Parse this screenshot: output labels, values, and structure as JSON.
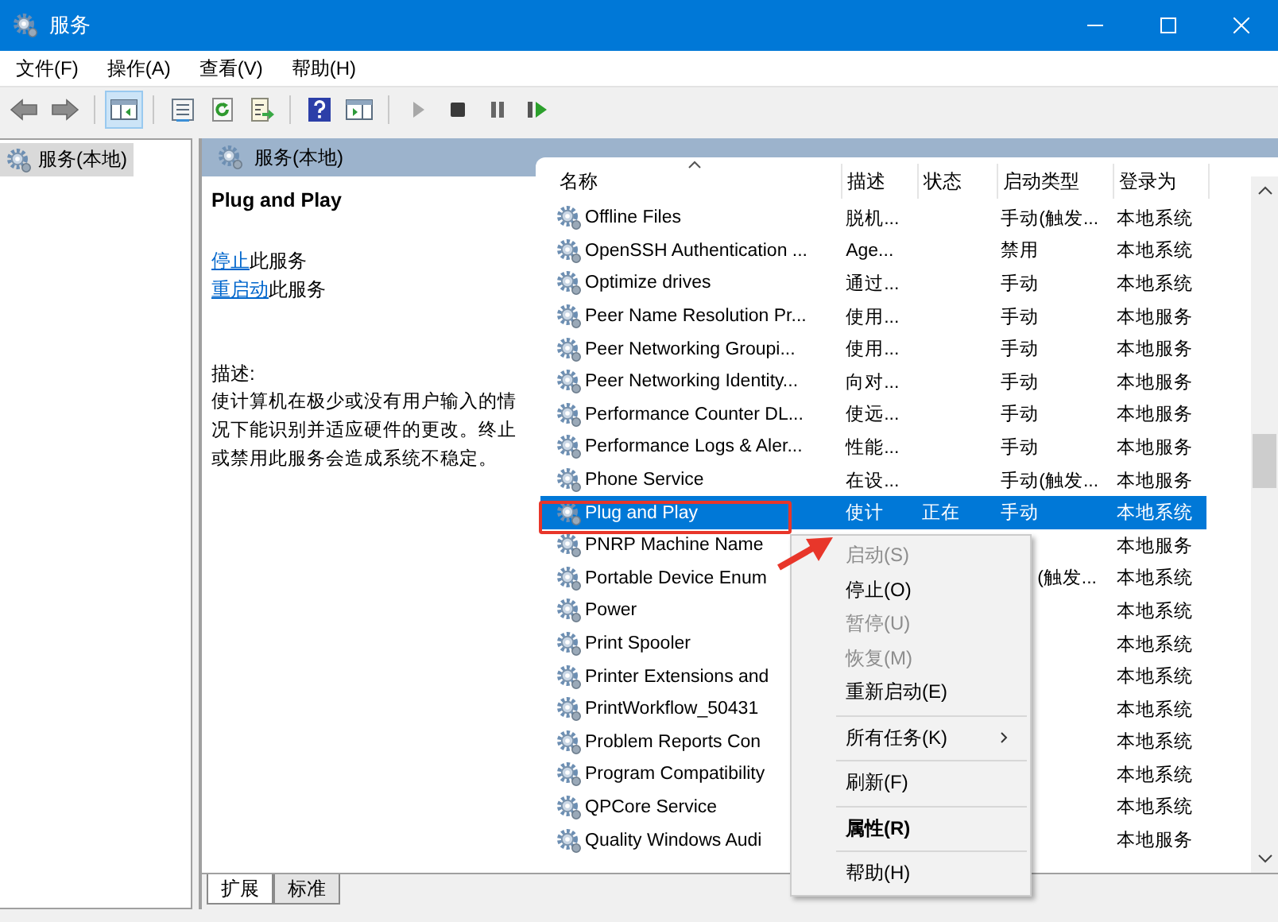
{
  "window": {
    "title": "服务"
  },
  "menu": [
    "文件(F)",
    "操作(A)",
    "查看(V)",
    "帮助(H)"
  ],
  "toolbar": [
    {
      "kind": "back",
      "selected": false
    },
    {
      "kind": "forward",
      "selected": false
    },
    {
      "kind": "sep"
    },
    {
      "kind": "tree",
      "selected": true
    },
    {
      "kind": "sep"
    },
    {
      "kind": "props",
      "selected": false
    },
    {
      "kind": "refresh",
      "selected": false
    },
    {
      "kind": "export",
      "selected": false
    },
    {
      "kind": "sep"
    },
    {
      "kind": "help",
      "selected": false
    },
    {
      "kind": "pane",
      "selected": false
    },
    {
      "kind": "sep"
    },
    {
      "kind": "play",
      "selected": false,
      "disabled": true
    },
    {
      "kind": "stop",
      "selected": false,
      "disabled": false
    },
    {
      "kind": "pause",
      "selected": false,
      "disabled": false
    },
    {
      "kind": "resume",
      "selected": false,
      "disabled": false
    }
  ],
  "tree": [
    {
      "label": "服务(本地)",
      "selected": true
    }
  ],
  "panel": {
    "title": "服务(本地)"
  },
  "detail": {
    "title": "Plug and Play",
    "actions": [
      {
        "link": "停止",
        "text": "此服务"
      },
      {
        "link": "重启动",
        "text": "此服务"
      }
    ],
    "description_label": "描述:",
    "description": "使计算机在极少或没有用户输入的情况下能识别并适应硬件的更改。终止或禁用此服务会造成系统不稳定。"
  },
  "table": {
    "columns": [
      "名称",
      "描述",
      "状态",
      "启动类型",
      "登录为"
    ],
    "rows": [
      {
        "name": "Offline Files",
        "desc": "脱机...",
        "startup": "手动(触发...",
        "logon": "本地系统",
        "selected": false
      },
      {
        "name": "OpenSSH Authentication ...",
        "desc": "Age...",
        "startup": "禁用",
        "logon": "本地系统",
        "selected": false
      },
      {
        "name": "Optimize drives",
        "desc": "通过...",
        "startup": "手动",
        "logon": "本地系统",
        "selected": false
      },
      {
        "name": "Peer Name Resolution Pr...",
        "desc": "使用...",
        "startup": "手动",
        "logon": "本地服务",
        "selected": false
      },
      {
        "name": "Peer Networking Groupi...",
        "desc": "使用...",
        "startup": "手动",
        "logon": "本地服务",
        "selected": false
      },
      {
        "name": "Peer Networking Identity...",
        "desc": "向对...",
        "startup": "手动",
        "logon": "本地服务",
        "selected": false
      },
      {
        "name": "Performance Counter DL...",
        "desc": "使远...",
        "startup": "手动",
        "logon": "本地服务",
        "selected": false
      },
      {
        "name": "Performance Logs & Aler...",
        "desc": "性能...",
        "startup": "手动",
        "logon": "本地服务",
        "selected": false
      },
      {
        "name": "Phone Service",
        "desc": "在设...",
        "startup": "手动(触发...",
        "logon": "本地服务",
        "selected": false
      },
      {
        "name": "Plug and Play",
        "desc": "使计",
        "status": "正在",
        "startup": "手动",
        "logon": "本地系统",
        "selected": true
      },
      {
        "name": "PNRP Machine Name",
        "logon": "本地服务",
        "selected": false
      },
      {
        "name": "Portable Device Enum",
        "startup": "(触发...",
        "covered": true,
        "logon": "本地系统",
        "selected": false
      },
      {
        "name": "Power",
        "logon": "本地系统",
        "selected": false
      },
      {
        "name": "Print Spooler",
        "logon": "本地系统",
        "selected": false
      },
      {
        "name": "Printer Extensions and",
        "logon": "本地系统",
        "selected": false
      },
      {
        "name": "PrintWorkflow_50431",
        "logon": "本地系统",
        "selected": false
      },
      {
        "name": "Problem Reports Con",
        "logon": "本地系统",
        "selected": false
      },
      {
        "name": "Program Compatibility",
        "logon": "本地系统",
        "selected": false
      },
      {
        "name": "QPCore Service",
        "logon": "本地系统",
        "selected": false
      },
      {
        "name": "Quality Windows Audi",
        "logon": "本地服务",
        "selected": false
      }
    ]
  },
  "context_menu": [
    {
      "kind": "item",
      "label": "启动(S)",
      "disabled": true,
      "bold": false
    },
    {
      "kind": "item",
      "label": "停止(O)",
      "disabled": false,
      "bold": false
    },
    {
      "kind": "item",
      "label": "暂停(U)",
      "disabled": true,
      "bold": false
    },
    {
      "kind": "item",
      "label": "恢复(M)",
      "disabled": true,
      "bold": false
    },
    {
      "kind": "item",
      "label": "重新启动(E)",
      "disabled": false,
      "bold": false
    },
    {
      "kind": "separator"
    },
    {
      "kind": "submenu",
      "label": "所有任务(K)",
      "disabled": false,
      "bold": false
    },
    {
      "kind": "separator"
    },
    {
      "kind": "item",
      "label": "刷新(F)",
      "disabled": false,
      "bold": false
    },
    {
      "kind": "separator"
    },
    {
      "kind": "item",
      "label": "属性(R)",
      "disabled": false,
      "bold": true
    },
    {
      "kind": "separator"
    },
    {
      "kind": "item",
      "label": "帮助(H)",
      "disabled": false,
      "bold": false
    }
  ],
  "tabs": [
    {
      "label": "扩展",
      "selected": true
    },
    {
      "label": "标准",
      "selected": false
    }
  ]
}
